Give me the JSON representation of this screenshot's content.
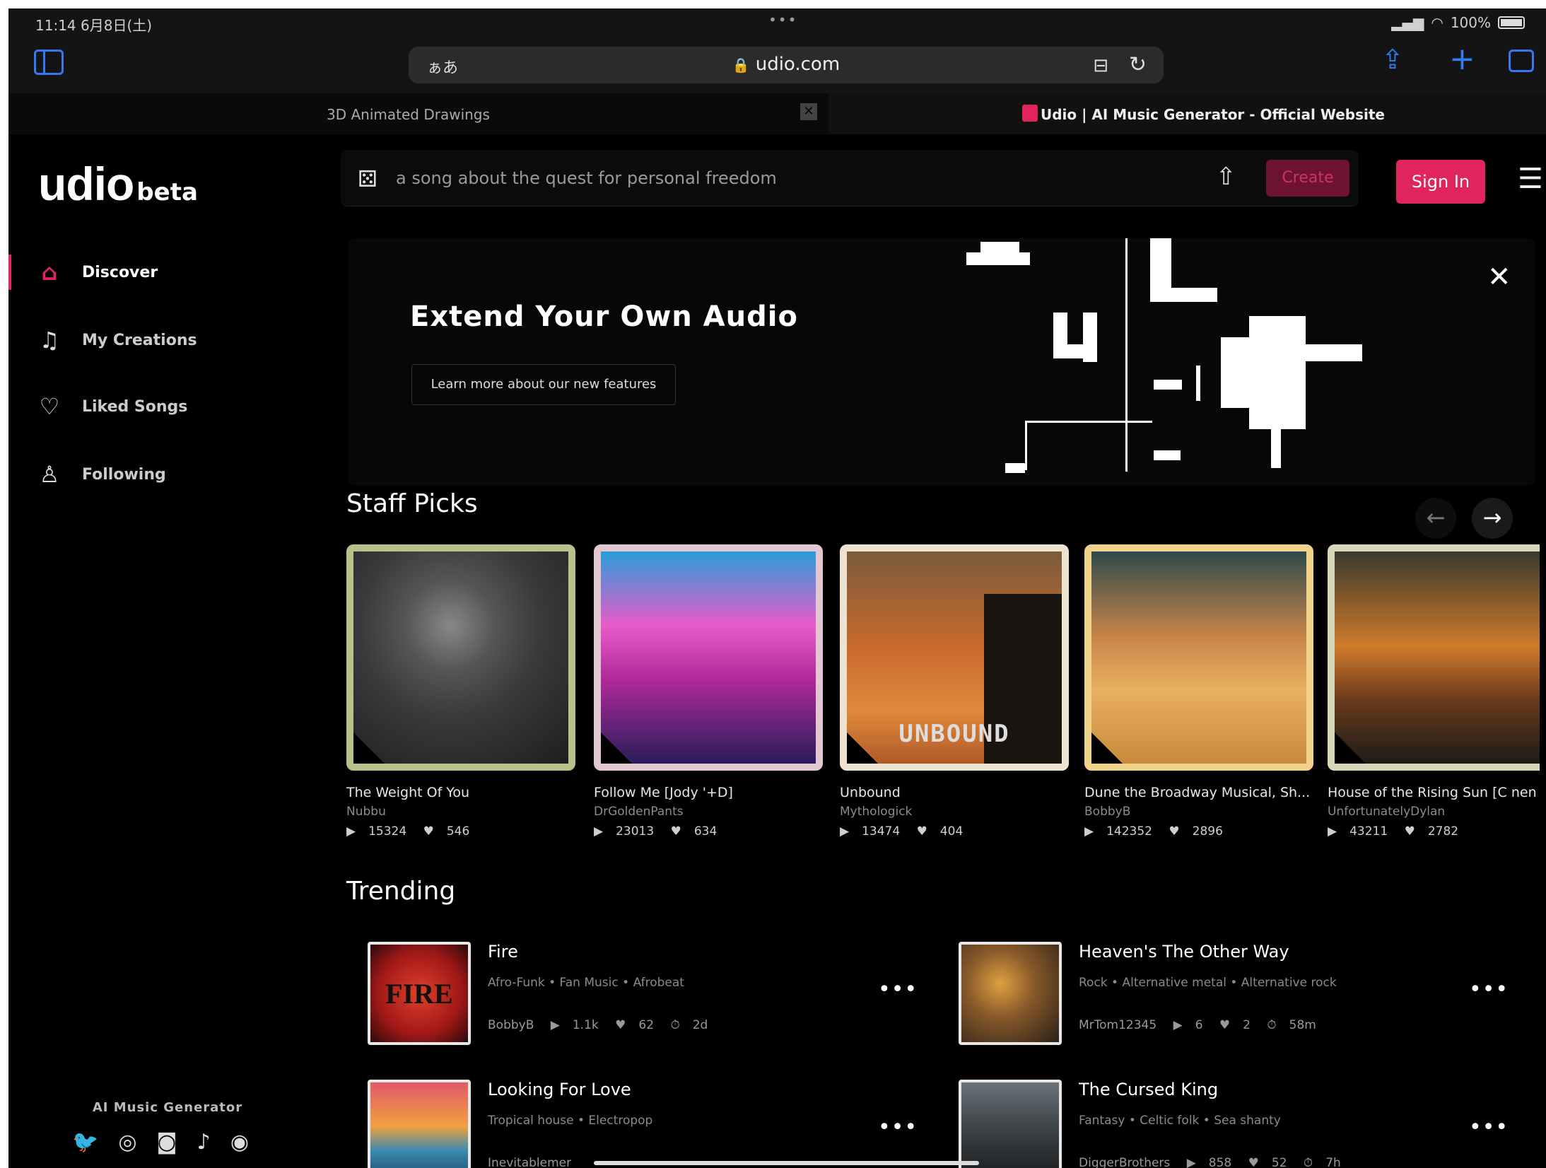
{
  "status": {
    "time": "11:14  6月8日(土)",
    "dots": "•••",
    "battery": "100%"
  },
  "browser": {
    "aa_label": "ぁあ",
    "url": "udio.com"
  },
  "tabs": [
    {
      "label": "3D Animated Drawings",
      "close": "✕"
    },
    {
      "label": "Udio | AI Music Generator - Official Website"
    }
  ],
  "logo": {
    "main": "udio",
    "sub": "beta"
  },
  "nav": [
    {
      "label": "Discover",
      "icon": "home-icon"
    },
    {
      "label": "My Creations",
      "icon": "music-note-icon"
    },
    {
      "label": "Liked Songs",
      "icon": "heart-icon"
    },
    {
      "label": "Following",
      "icon": "user-icon"
    }
  ],
  "sidebar_footer": {
    "title": "AI Music Generator",
    "socials": [
      "twitter-icon",
      "instagram-icon",
      "discord-icon",
      "tiktok-icon",
      "reddit-icon"
    ]
  },
  "topbar": {
    "prompt_placeholder": "a song about the quest for personal freedom",
    "create_label": "Create",
    "signin_label": "Sign In"
  },
  "banner": {
    "title": "Extend Your Own Audio",
    "link_label": "Learn more about our new features"
  },
  "staff_picks": {
    "title": "Staff Picks",
    "items": [
      {
        "title": "The Weight Of You",
        "artist": "Nubbu",
        "plays": "15324",
        "likes": "546",
        "border": "#b9c08a"
      },
      {
        "title": "Follow Me [Jody '+D]",
        "artist": "DrGoldenPants",
        "plays": "23013",
        "likes": "634",
        "border": "#e3c7d0"
      },
      {
        "title": "Unbound",
        "artist": "Mythologick",
        "plays": "13474",
        "likes": "404",
        "label": "UNBOUND",
        "border": "#eee2d0"
      },
      {
        "title": "Dune the Broadway Musical, Sh...",
        "artist": "BobbyB",
        "plays": "142352",
        "likes": "2896",
        "border": "#f0d28a"
      },
      {
        "title": "House of the Rising Sun [C nen",
        "artist": "UnfortunatelyDylan",
        "plays": "43211",
        "likes": "2782",
        "border": "#d8d8b8"
      }
    ]
  },
  "trending": {
    "title": "Trending",
    "items": [
      {
        "name": "Fire",
        "tags": "Afro-Funk  •  Fan Music  •  Afrobeat",
        "user": "BobbyB",
        "plays": "1.1k",
        "likes": "62",
        "age": "2d",
        "thumb_text": "FIRE"
      },
      {
        "name": "Heaven's The Other Way",
        "tags": "Rock  •  Alternative metal  •  Alternative rock",
        "user": "MrTom12345",
        "plays": "6",
        "likes": "2",
        "age": "58m"
      },
      {
        "name": "Looking For Love",
        "tags": "Tropical house  •  Electropop",
        "user": "Inevitablemer",
        "plays": "",
        "likes": "",
        "age": ""
      },
      {
        "name": "The Cursed King",
        "tags": "Fantasy  •  Celtic folk  •  Sea shanty",
        "user": "DiggerBrothers",
        "plays": "858",
        "likes": "52",
        "age": "7h"
      }
    ]
  },
  "glyphs": {
    "play": "▶",
    "heart": "♥",
    "clock": "⏱",
    "more": "•••",
    "close": "✕",
    "left": "←",
    "right": "→"
  }
}
